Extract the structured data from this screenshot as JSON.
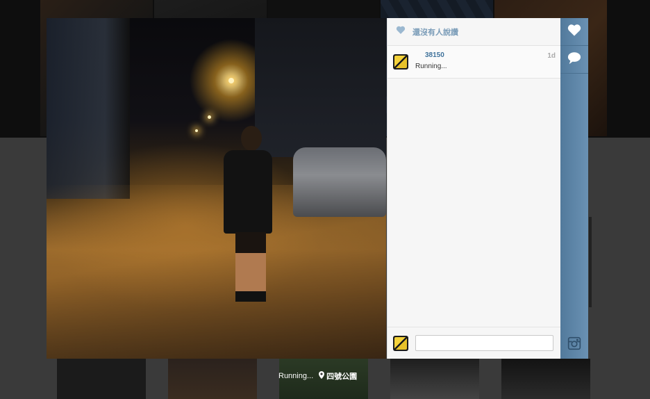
{
  "photo": {
    "caption": "Running...",
    "location": "四號公園"
  },
  "panel": {
    "likes_text": "還沒有人說讚",
    "caption_user": "38150",
    "caption_text": "Running...",
    "caption_time": "1d",
    "comment_placeholder": ""
  },
  "actions": {
    "like_icon": "heart-icon",
    "comment_icon": "speech-bubble-icon",
    "logo_icon": "instagram-camera-icon"
  },
  "colors": {
    "accent": "#3f729b",
    "action_bar": "#5f86a8",
    "likes_text": "#7a9cb8"
  }
}
